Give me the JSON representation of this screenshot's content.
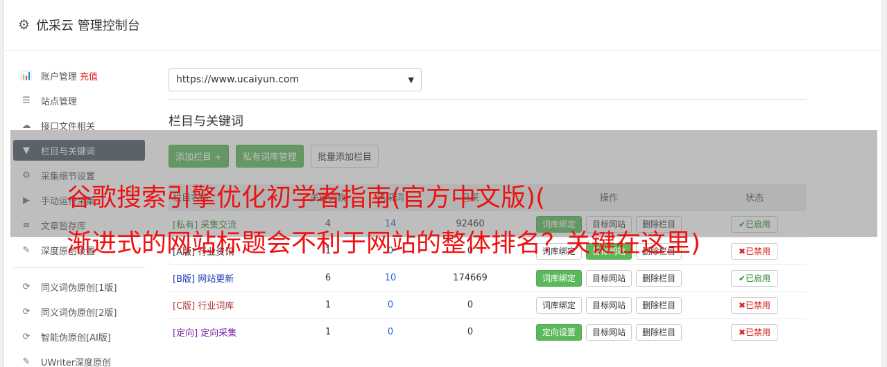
{
  "header": {
    "title": "优采云 管理控制台",
    "icon": "gear-icon"
  },
  "sidebar": {
    "items": [
      {
        "label": "账户管理",
        "extra": "充值",
        "icon": "chart-icon"
      },
      {
        "label": "站点管理",
        "icon": "server-icon"
      },
      {
        "label": "接口文件相关",
        "icon": "cloud-upload-icon"
      },
      {
        "label": "栏目与关键词",
        "icon": "filter-icon",
        "active": true
      },
      {
        "label": "采集细节设置",
        "icon": "cogs-icon"
      },
      {
        "label": "手动运行采集",
        "icon": "play-circle-icon"
      },
      {
        "label": "文章暂存库",
        "icon": "database-icon"
      },
      {
        "label": "深度原创设置",
        "icon": "edit-icon"
      }
    ],
    "items2": [
      {
        "label": "同义词伪原创[1版]",
        "icon": "refresh-icon"
      },
      {
        "label": "同义词伪原创[2版]",
        "icon": "refresh-icon"
      },
      {
        "label": "智能伪原创[AI版]",
        "icon": "refresh-icon"
      },
      {
        "label": "UWriter深度原创",
        "icon": "edit-icon"
      }
    ]
  },
  "main": {
    "site_select": "https://www.ucaiyun.com",
    "section_title": "栏目与关键词",
    "buttons": {
      "add_column": "添加栏目 +",
      "private_lib": "私有词库管理",
      "batch_add": "批量添加栏目"
    },
    "table": {
      "headers": [
        "栏目名称",
        "关键词数",
        "已采词",
        "已采",
        "操作",
        "状态"
      ],
      "rows": [
        {
          "tag": "[私有]",
          "name": "采集交流",
          "c1": "4",
          "c2": "14",
          "c3": "92460",
          "bind_label": "词库绑定",
          "target": "目标网站",
          "del": "删除栏目",
          "status": "已启用"
        },
        {
          "tag": "[A版]",
          "name": "行业资讯",
          "c1": "1",
          "c2": "0",
          "c3": "0",
          "bind_label": "词库绑定",
          "target": "目标网站",
          "del": "删除栏目",
          "status": "已禁用"
        },
        {
          "tag": "[B版]",
          "name": "网站更新",
          "c1": "6",
          "c2": "10",
          "c3": "174669",
          "bind_label": "词库绑定",
          "target": "目标网站",
          "del": "删除栏目",
          "status": "已启用"
        },
        {
          "tag": "[C版]",
          "name": "行业词库",
          "c1": "1",
          "c2": "0",
          "c3": "0",
          "bind_label": "词库绑定",
          "target": "目标网站",
          "del": "删除栏目",
          "status": "已禁用"
        },
        {
          "tag": "[定向]",
          "name": "定向采集",
          "c1": "1",
          "c2": "0",
          "c3": "0",
          "bind_label": "定向设置",
          "target": "目标网站",
          "del": "删除栏目",
          "status": "已禁用"
        }
      ]
    }
  },
  "watermark": {
    "line1": "谷歌搜索引擎优化初学者指南(官方中文版)(",
    "line2": "渐进式的网站标题会不利于网站的整体排名？关键在这里)"
  }
}
